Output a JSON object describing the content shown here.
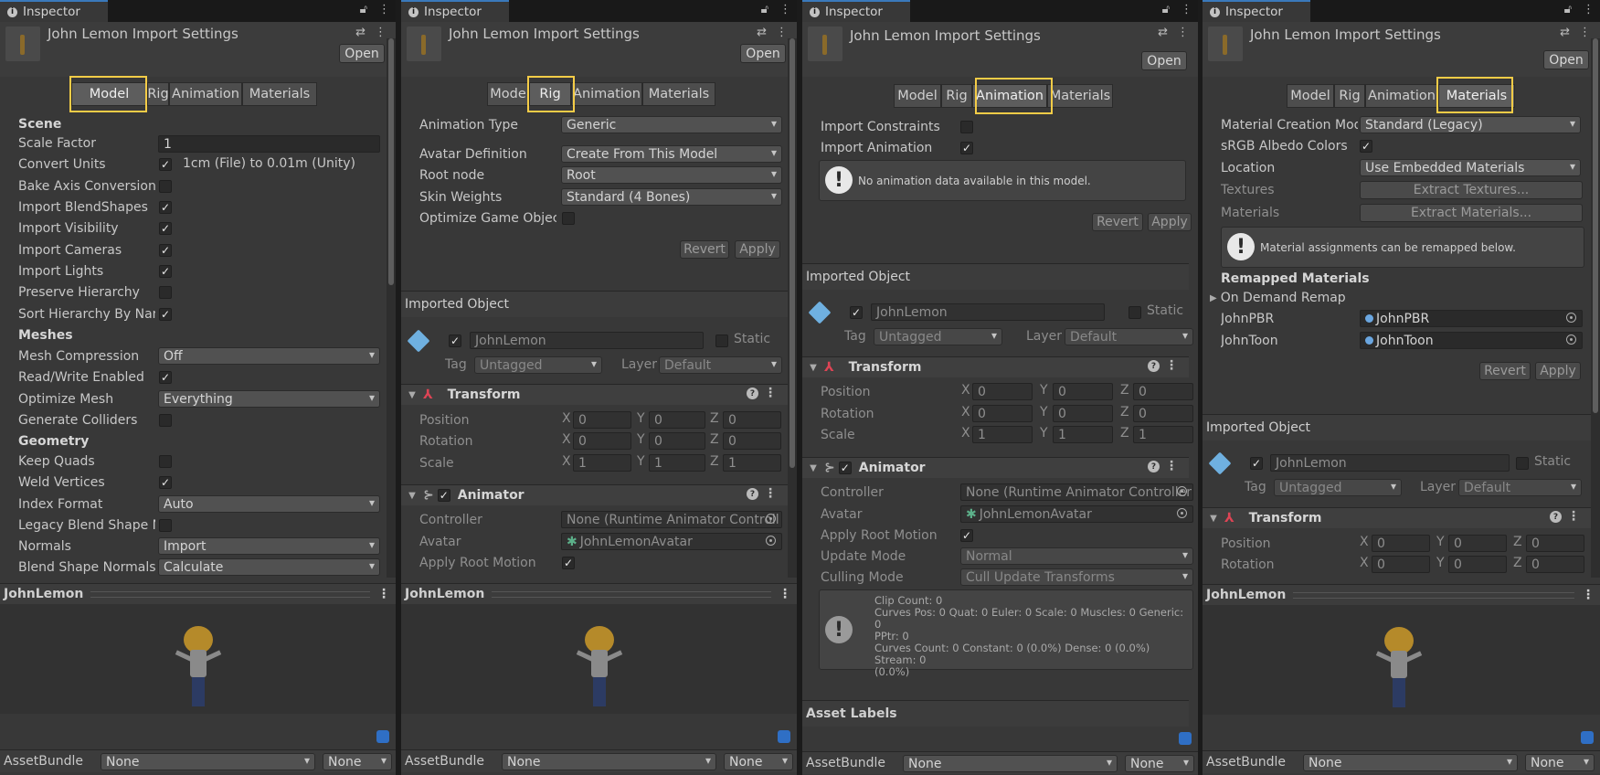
{
  "panels": [
    {
      "tab_label": "Inspector",
      "title": "John Lemon Import Settings",
      "open_button": "Open",
      "tabs": [
        "Model",
        "Rig",
        "Animation",
        "Materials"
      ],
      "active_tab": "Model",
      "model": {
        "scene_header": "Scene",
        "scale_factor_label": "Scale Factor",
        "scale_factor_value": "1",
        "convert_units_label": "Convert Units",
        "convert_units_text": "1cm (File) to 0.01m (Unity)",
        "bake_axis_label": "Bake Axis Conversion",
        "import_blendshapes_label": "Import BlendShapes",
        "import_visibility_label": "Import Visibility",
        "import_cameras_label": "Import Cameras",
        "import_lights_label": "Import Lights",
        "preserve_hierarchy_label": "Preserve Hierarchy",
        "sort_hierarchy_label": "Sort Hierarchy By Nam",
        "meshes_header": "Meshes",
        "mesh_compression_label": "Mesh Compression",
        "mesh_compression_value": "Off",
        "read_write_label": "Read/Write Enabled",
        "optimize_mesh_label": "Optimize Mesh",
        "optimize_mesh_value": "Everything",
        "generate_colliders_label": "Generate Colliders",
        "geometry_header": "Geometry",
        "keep_quads_label": "Keep Quads",
        "weld_vertices_label": "Weld Vertices",
        "index_format_label": "Index Format",
        "index_format_value": "Auto",
        "legacy_blend_label": "Legacy Blend Shape N",
        "normals_label": "Normals",
        "normals_value": "Import",
        "blend_normals_label": "Blend Shape Normals",
        "blend_normals_value": "Calculate"
      },
      "preview_name": "JohnLemon",
      "assetbundle_label": "AssetBundle",
      "assetbundle_value": "None",
      "assetbundle_variant": "None"
    },
    {
      "tab_label": "Inspector",
      "title": "John Lemon Import Settings",
      "open_button": "Open",
      "tabs": [
        "Model",
        "Rig",
        "Animation",
        "Materials"
      ],
      "tab_first_visible": "Mode",
      "active_tab": "Rig",
      "rig": {
        "animation_type_label": "Animation Type",
        "animation_type_value": "Generic",
        "avatar_def_label": "Avatar Definition",
        "avatar_def_value": "Create From This Model",
        "root_node_label": "Root node",
        "root_node_value": "Root",
        "skin_weights_label": "Skin Weights",
        "skin_weights_value": "Standard (4 Bones)",
        "optimize_go_label": "Optimize Game Object"
      },
      "revert": "Revert",
      "apply": "Apply",
      "imported_object": "Imported Object",
      "object_name": "JohnLemon",
      "static_label": "Static",
      "tag_label": "Tag",
      "tag_value": "Untagged",
      "layer_label": "Layer",
      "layer_value": "Default",
      "transform": "Transform",
      "position_label": "Position",
      "rotation_label": "Rotation",
      "scale_label": "Scale",
      "pos": [
        "0",
        "0",
        "0"
      ],
      "rot": [
        "0",
        "0",
        "0"
      ],
      "scl": [
        "1",
        "1",
        "1"
      ],
      "animator": "Animator",
      "controller_label": "Controller",
      "controller_value": "None (Runtime Animator Controll",
      "avatar_label": "Avatar",
      "avatar_value": "JohnLemonAvatar",
      "apply_root_label": "Apply Root Motion",
      "preview_name": "JohnLemon",
      "assetbundle_label": "AssetBundle",
      "assetbundle_value": "None",
      "assetbundle_variant": "None"
    },
    {
      "tab_label": "Inspector",
      "title": "John Lemon Import Settings",
      "open_button": "Open",
      "tabs": [
        "Model",
        "Rig",
        "Animation",
        "Materials"
      ],
      "active_tab": "Animation",
      "anim": {
        "import_constraints_label": "Import Constraints",
        "import_animation_label": "Import Animation",
        "no_data_msg": "No animation data available in this model."
      },
      "revert": "Revert",
      "apply": "Apply",
      "imported_object": "Imported Object",
      "object_name": "JohnLemon",
      "static_label": "Static",
      "tag_label": "Tag",
      "tag_value": "Untagged",
      "layer_label": "Layer",
      "layer_value": "Default",
      "transform": "Transform",
      "position_label": "Position",
      "rotation_label": "Rotation",
      "scale_label": "Scale",
      "pos": [
        "0",
        "0",
        "0"
      ],
      "rot": [
        "0",
        "0",
        "0"
      ],
      "scl": [
        "1",
        "1",
        "1"
      ],
      "animator": "Animator",
      "controller_label": "Controller",
      "controller_value": "None (Runtime Animator Controller)",
      "avatar_label": "Avatar",
      "avatar_value": "JohnLemonAvatar",
      "apply_root_label": "Apply Root Motion",
      "update_mode_label": "Update Mode",
      "update_mode_value": "Normal",
      "culling_mode_label": "Culling Mode",
      "culling_mode_value": "Cull Update Transforms",
      "clip_info": [
        "Clip Count: 0",
        "Curves Pos: 0 Quat: 0 Euler: 0 Scale: 0 Muscles: 0 Generic: 0",
        "PPtr: 0",
        "Curves Count: 0 Constant: 0 (0.0%) Dense: 0 (0.0%) Stream: 0",
        "(0.0%)"
      ],
      "asset_labels": "Asset Labels",
      "assetbundle_label": "AssetBundle",
      "assetbundle_value": "None",
      "assetbundle_variant": "None"
    },
    {
      "tab_label": "Inspector",
      "title": "John Lemon Import Settings",
      "open_button": "Open",
      "tabs": [
        "Model",
        "Rig",
        "Animation",
        "Materials"
      ],
      "active_tab": "Materials",
      "mat": {
        "creation_mode_label": "Material Creation Mod",
        "creation_mode_value": "Standard (Legacy)",
        "srgb_label": "sRGB Albedo Colors",
        "location_label": "Location",
        "location_value": "Use Embedded Materials",
        "textures_label": "Textures",
        "extract_textures": "Extract Textures...",
        "materials_label": "Materials",
        "extract_materials": "Extract Materials...",
        "remap_msg": "Material assignments can be remapped below.",
        "remapped_header": "Remapped Materials",
        "on_demand": "On Demand Remap",
        "slot1_label": "JohnPBR",
        "slot1_value": "JohnPBR",
        "slot2_label": "JohnToon",
        "slot2_value": "JohnToon"
      },
      "revert": "Revert",
      "apply": "Apply",
      "imported_object": "Imported Object",
      "object_name": "JohnLemon",
      "static_label": "Static",
      "tag_label": "Tag",
      "tag_value": "Untagged",
      "layer_label": "Layer",
      "layer_value": "Default",
      "transform": "Transform",
      "position_label": "Position",
      "rotation_label": "Rotation",
      "pos": [
        "0",
        "0",
        "0"
      ],
      "rot": [
        "0",
        "0",
        "0"
      ],
      "preview_name": "JohnLemon",
      "assetbundle_label": "AssetBundle",
      "assetbundle_value": "None",
      "assetbundle_variant": "None"
    }
  ],
  "colors": {
    "highlight": "#f4cc47",
    "accent": "#3a79bb",
    "panel_bg": "#383838"
  }
}
